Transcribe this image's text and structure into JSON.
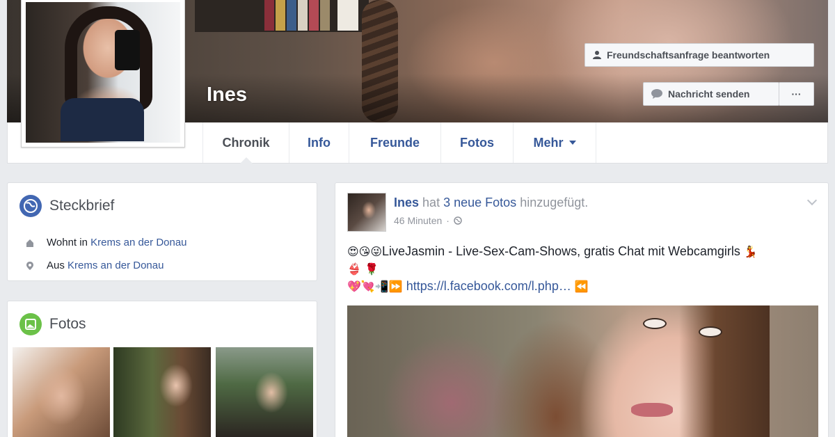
{
  "profile": {
    "name": "Ines",
    "buttons": {
      "friend_request": "Freundschaftsanfrage beantworten",
      "send_message": "Nachricht senden",
      "more": "···"
    }
  },
  "tabs": [
    {
      "label": "Chronik",
      "active": true
    },
    {
      "label": "Info"
    },
    {
      "label": "Freunde"
    },
    {
      "label": "Fotos"
    },
    {
      "label": "Mehr"
    }
  ],
  "intro": {
    "title": "Steckbrief",
    "lives_prefix": "Wohnt in",
    "lives_place": "Krems an der Donau",
    "from_prefix": "Aus",
    "from_place": "Krems an der Donau"
  },
  "photos": {
    "title": "Fotos"
  },
  "post": {
    "author": "Ines",
    "action_1": "hat",
    "photos_link": "3 neue Fotos",
    "action_2": "hinzugefügt.",
    "time": "46 Minuten",
    "time_sep": "·",
    "emoji_prefix": "😍😘😜",
    "text": "LiveJasmin - Live-Sex-Cam-Shows, gratis Chat mit Webcamgirls",
    "emoji_suffix": "💃",
    "emoji_line2": "👙 🌹",
    "emoji_line3": "💖💘📲⏩",
    "link": "https://l.facebook.com/l.php…",
    "link_end": "⏪"
  },
  "colors": {
    "link": "#365899",
    "background": "#e9ebee",
    "intro_icon": "#4267b2",
    "photos_icon": "#6bc148"
  }
}
